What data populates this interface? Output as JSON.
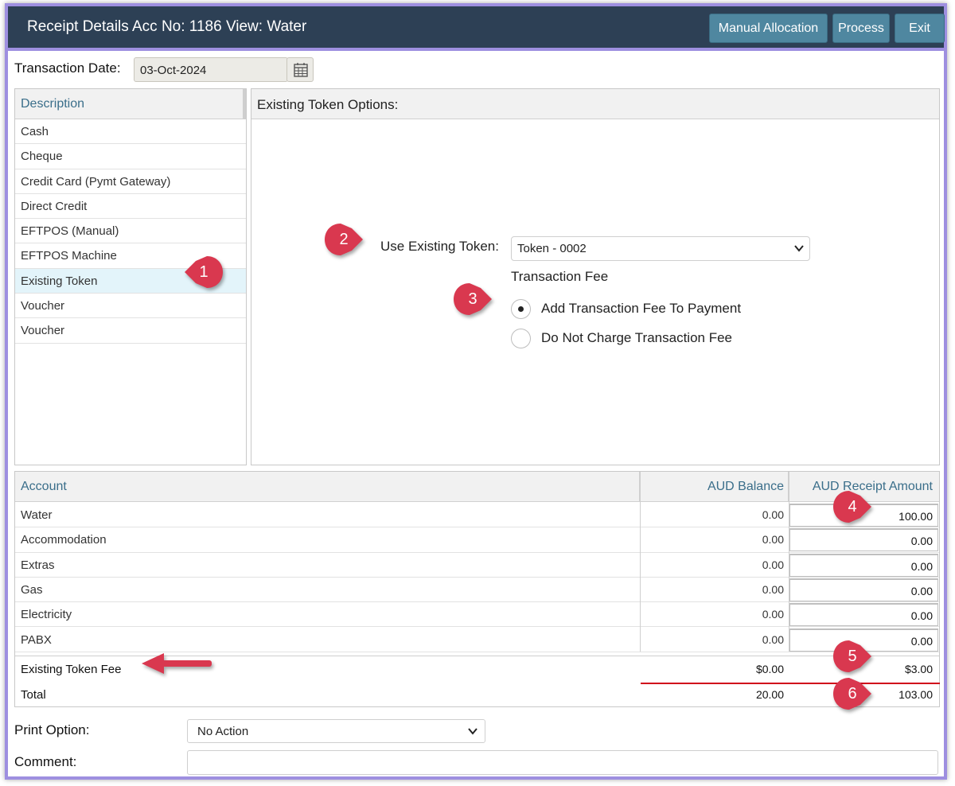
{
  "window": {
    "title": "Receipt Details Acc No: 1186 View: Water",
    "buttons": {
      "manual_allocation": "Manual Allocation",
      "process": "Process",
      "exit": "Exit"
    }
  },
  "transaction_date": {
    "label": "Transaction Date:",
    "value": "03-Oct-2024"
  },
  "description": {
    "header": "Description",
    "items": [
      {
        "label": "Cash"
      },
      {
        "label": "Cheque"
      },
      {
        "label": "Credit Card (Pymt Gateway)"
      },
      {
        "label": "Direct Credit"
      },
      {
        "label": "EFTPOS (Manual)"
      },
      {
        "label": "EFTPOS Machine"
      },
      {
        "label": "Existing Token",
        "selected": true
      },
      {
        "label": "Voucher"
      },
      {
        "label": "Voucher"
      }
    ]
  },
  "options": {
    "header": "Existing Token Options:",
    "token_label": "Use Existing Token:",
    "token_value": "Token  - 0002",
    "fee_heading": "Transaction Fee",
    "radio_add": "Add Transaction Fee To Payment",
    "radio_none": "Do Not Charge Transaction Fee",
    "selected": "add"
  },
  "accounts": {
    "headers": {
      "account": "Account",
      "balance": "AUD Balance",
      "receipt": "AUD Receipt Amount"
    },
    "rows": [
      {
        "name": "Water",
        "balance": "0.00",
        "receipt": "100.00"
      },
      {
        "name": "Accommodation",
        "balance": "0.00",
        "receipt": "0.00"
      },
      {
        "name": "Extras",
        "balance": "0.00",
        "receipt": "0.00"
      },
      {
        "name": "Gas",
        "balance": "0.00",
        "receipt": "0.00"
      },
      {
        "name": "Electricity",
        "balance": "0.00",
        "receipt": "0.00"
      },
      {
        "name": "PABX",
        "balance": "0.00",
        "receipt": "0.00"
      }
    ],
    "fee": {
      "name": "Existing Token Fee",
      "balance": "$0.00",
      "receipt": "$3.00"
    },
    "total": {
      "name": "Total",
      "balance": "20.00",
      "receipt": "103.00"
    }
  },
  "print_option": {
    "label": "Print Option:",
    "value": "No Action"
  },
  "comment": {
    "label": "Comment:",
    "value": ""
  },
  "annotations": [
    "1",
    "2",
    "3",
    "4",
    "5",
    "6"
  ],
  "colors": {
    "titlebar": "#2d4055",
    "button": "#4f87a0",
    "frame": "#9e8fe0",
    "callout": "#d9384f",
    "selected_row": "#e3f4fa",
    "total_line": "#d0021b"
  }
}
